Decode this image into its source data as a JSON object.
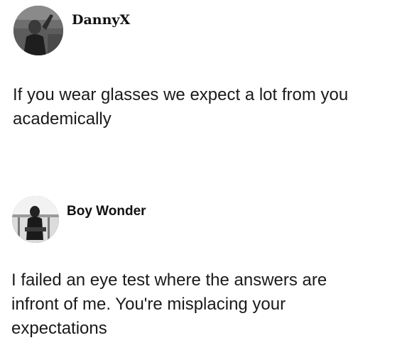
{
  "posts": [
    {
      "username": "DannyX",
      "avatar_icon": "user-avatar-icon",
      "text_lines": [
        "If you wear glasses we expect a lot from you",
        "academically"
      ]
    },
    {
      "username": "Boy Wonder",
      "avatar_icon": "user-avatar-icon",
      "text_lines": [
        "I failed an eye test where the answers are",
        "infront of me. You're misplacing your",
        "expectations"
      ]
    }
  ]
}
